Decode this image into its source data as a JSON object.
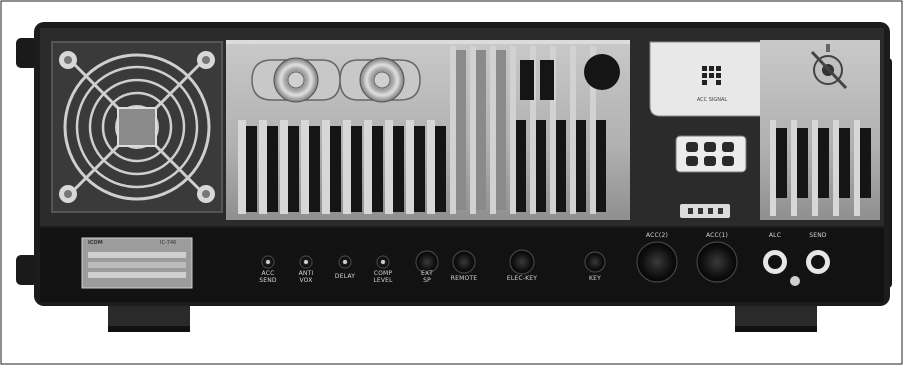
{
  "photo": {
    "subject": "transceiver-rear-panel",
    "colors": {
      "background": "#ffffff",
      "chassis": "#1c1c1c",
      "heatsink": "#b9b9b9",
      "fin_shadow": "#151515",
      "jack_panel": "#121212",
      "label_text": "#d8d8d8"
    }
  },
  "fan": {
    "icon": "fan-grille-icon"
  },
  "plate": {
    "brand": "ICOM",
    "model": "IC-746",
    "line1": "",
    "line2": ""
  },
  "mic_board_label": "ACC SIGNAL",
  "jacks": [
    {
      "label": "ACC\nSEND"
    },
    {
      "label": "ANTI\nVOX"
    },
    {
      "label": "DELAY"
    },
    {
      "label": "COMP\nLEVEL"
    },
    {
      "label": "EXT\nSP"
    },
    {
      "label": "REMOTE"
    },
    {
      "label": "ELEC-KEY"
    },
    {
      "label": "KEY"
    },
    {
      "label": "ACC(2)"
    },
    {
      "label": "ACC(1)"
    },
    {
      "label": "ALC"
    },
    {
      "label": "SEND"
    }
  ]
}
